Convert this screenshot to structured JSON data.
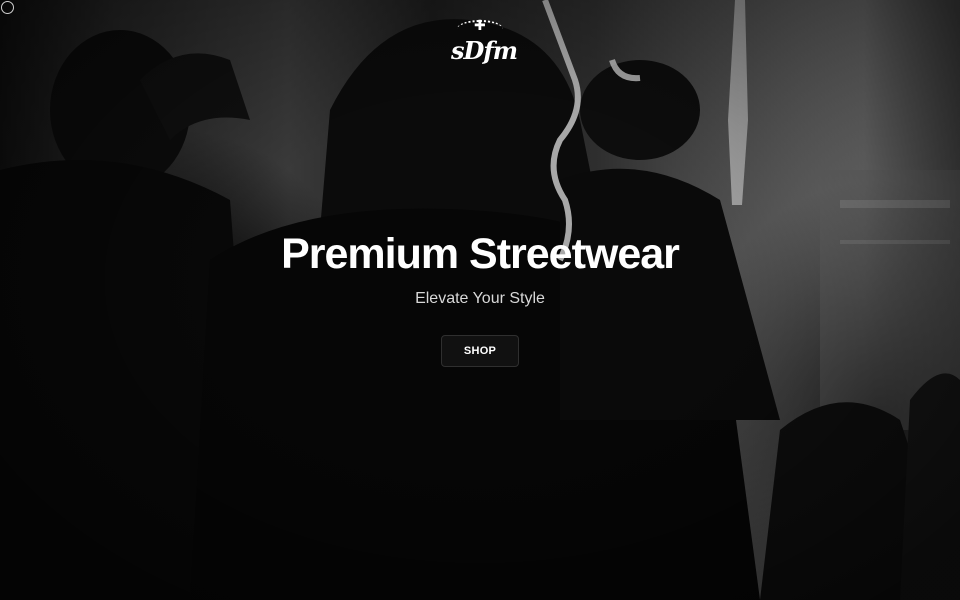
{
  "brand": {
    "logo_text": "sDfm",
    "logo_icon": "cross-icon"
  },
  "hero": {
    "title": "Premium Streetwear",
    "subtitle": "Elevate Your Style",
    "cta_label": "SHOP"
  },
  "colors": {
    "background": "#000000",
    "text": "#ffffff",
    "subtitle": "#d8d8d8",
    "button_bg": "#111111"
  }
}
